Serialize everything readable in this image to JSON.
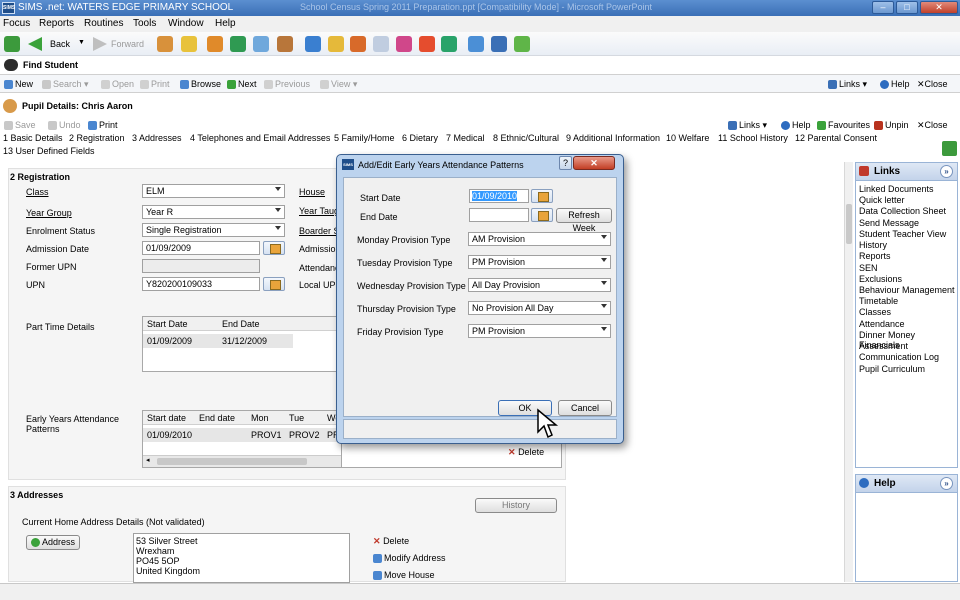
{
  "app": {
    "title": "SIMS .net: WATERS EDGE PRIMARY SCHOOL",
    "ghost_title": "School Census Spring 2011 Preparation.ppt [Compatibility Mode] - Microsoft PowerPoint",
    "logo": "SIMS",
    "window_buttons": {
      "minimize": "–",
      "maximize": "□",
      "close": "✕"
    }
  },
  "menu": [
    "Focus",
    "Reports",
    "Routines",
    "Tools",
    "Window",
    "Help"
  ],
  "nav_toolbar": {
    "back": "Back",
    "forward": "Forward"
  },
  "find_bar": {
    "title": "Find Student",
    "actions": {
      "new": "New",
      "search": "Search",
      "open": "Open",
      "print": "Print",
      "browse": "Browse",
      "next": "Next",
      "previous": "Previous",
      "view": "View",
      "links": "Links",
      "help": "Help",
      "close": "Close"
    }
  },
  "pupil_bar": {
    "title": "Pupil Details: Chris Aaron",
    "actions": {
      "save": "Save",
      "undo": "Undo",
      "print": "Print",
      "links": "Links",
      "help": "Help",
      "favourites": "Favourites",
      "unpin": "Unpin",
      "close": "Close"
    }
  },
  "section_links": {
    "row1": [
      "1 Basic Details",
      "2 Registration",
      "3 Addresses",
      "4 Telephones and Email Addresses",
      "5 Family/Home",
      "6 Dietary",
      "7 Medical",
      "8 Ethnic/Cultural",
      "9 Additional Information",
      "10 Welfare",
      "11 School History",
      "12 Parental Consent"
    ],
    "row2": [
      "13 User Defined Fields"
    ]
  },
  "registration": {
    "heading": "2 Registration",
    "class_label": "Class",
    "class_value": "ELM",
    "year_group_label": "Year Group",
    "year_group_value": "Year  R",
    "enrolment_label": "Enrolment Status",
    "enrolment_value": "Single Registration",
    "admission_date_label": "Admission Date",
    "admission_date_value": "01/09/2009",
    "former_upn_label": "Former UPN",
    "former_upn_value": "",
    "upn_label": "UPN",
    "upn_value": "Y820200109033",
    "house_label": "House",
    "year_taught_label": "Year Taught",
    "boarder_label": "Boarder Status",
    "admission_no_label": "Admission",
    "attendance_label": "Attendance",
    "local_upn_label": "Local UPN",
    "part_time_label": "Part Time Details",
    "part_time_headers": [
      "Start Date",
      "End Date"
    ],
    "part_time_rows": [
      [
        "01/09/2009",
        "31/12/2009"
      ]
    ],
    "eyap_label": "Early Years Attendance Patterns",
    "eyap_headers": [
      "Start date",
      "End date",
      "Mon",
      "Tue",
      "We"
    ],
    "eyap_rows": [
      [
        "01/09/2010",
        "",
        "PROV1",
        "PROV2",
        "PR"
      ]
    ],
    "delete_label": "Delete"
  },
  "addresses": {
    "heading": "3 Addresses",
    "history_button": "History",
    "current_label": "Current Home Address Details (Not validated)",
    "address_button": "Address",
    "address_lines": [
      "53 Silver Street",
      "Wrexham",
      "PO45 5OP",
      "United Kingdom"
    ],
    "delete": "Delete",
    "modify": "Modify Address",
    "move": "Move House"
  },
  "links_panel": {
    "title": "Links",
    "items": [
      "Linked Documents",
      "Quick letter",
      "Data Collection Sheet",
      "Send Message",
      "Student Teacher View",
      "History",
      "Reports",
      "SEN",
      "Exclusions",
      "Behaviour Management",
      "Timetable",
      "Classes",
      "Attendance",
      "Dinner Money Financials",
      "Assessment",
      "Communication Log",
      "Pupil Curriculum"
    ]
  },
  "help_panel": {
    "title": "Help"
  },
  "dialog": {
    "title": "Add/Edit Early Years Attendance Patterns",
    "help_button": "?",
    "close_button": "✕",
    "start_date_label": "Start Date",
    "start_date_value": "01/09/2010",
    "end_date_label": "End Date",
    "end_date_value": "",
    "refresh_week": "Refresh Week",
    "rows": [
      {
        "label": "Monday Provision Type",
        "value": "AM Provision"
      },
      {
        "label": "Tuesday Provision Type",
        "value": "PM Provision"
      },
      {
        "label": "Wednesday Provision Type",
        "value": "All Day Provision"
      },
      {
        "label": "Thursday Provision Type",
        "value": "No Provision All Day"
      },
      {
        "label": "Friday Provision Type",
        "value": "PM Provision"
      }
    ],
    "ok": "OK",
    "cancel": "Cancel"
  },
  "colors": {
    "accent": "#3a6fb6",
    "selection": "#3399ff",
    "close_red": "#c23e25"
  }
}
